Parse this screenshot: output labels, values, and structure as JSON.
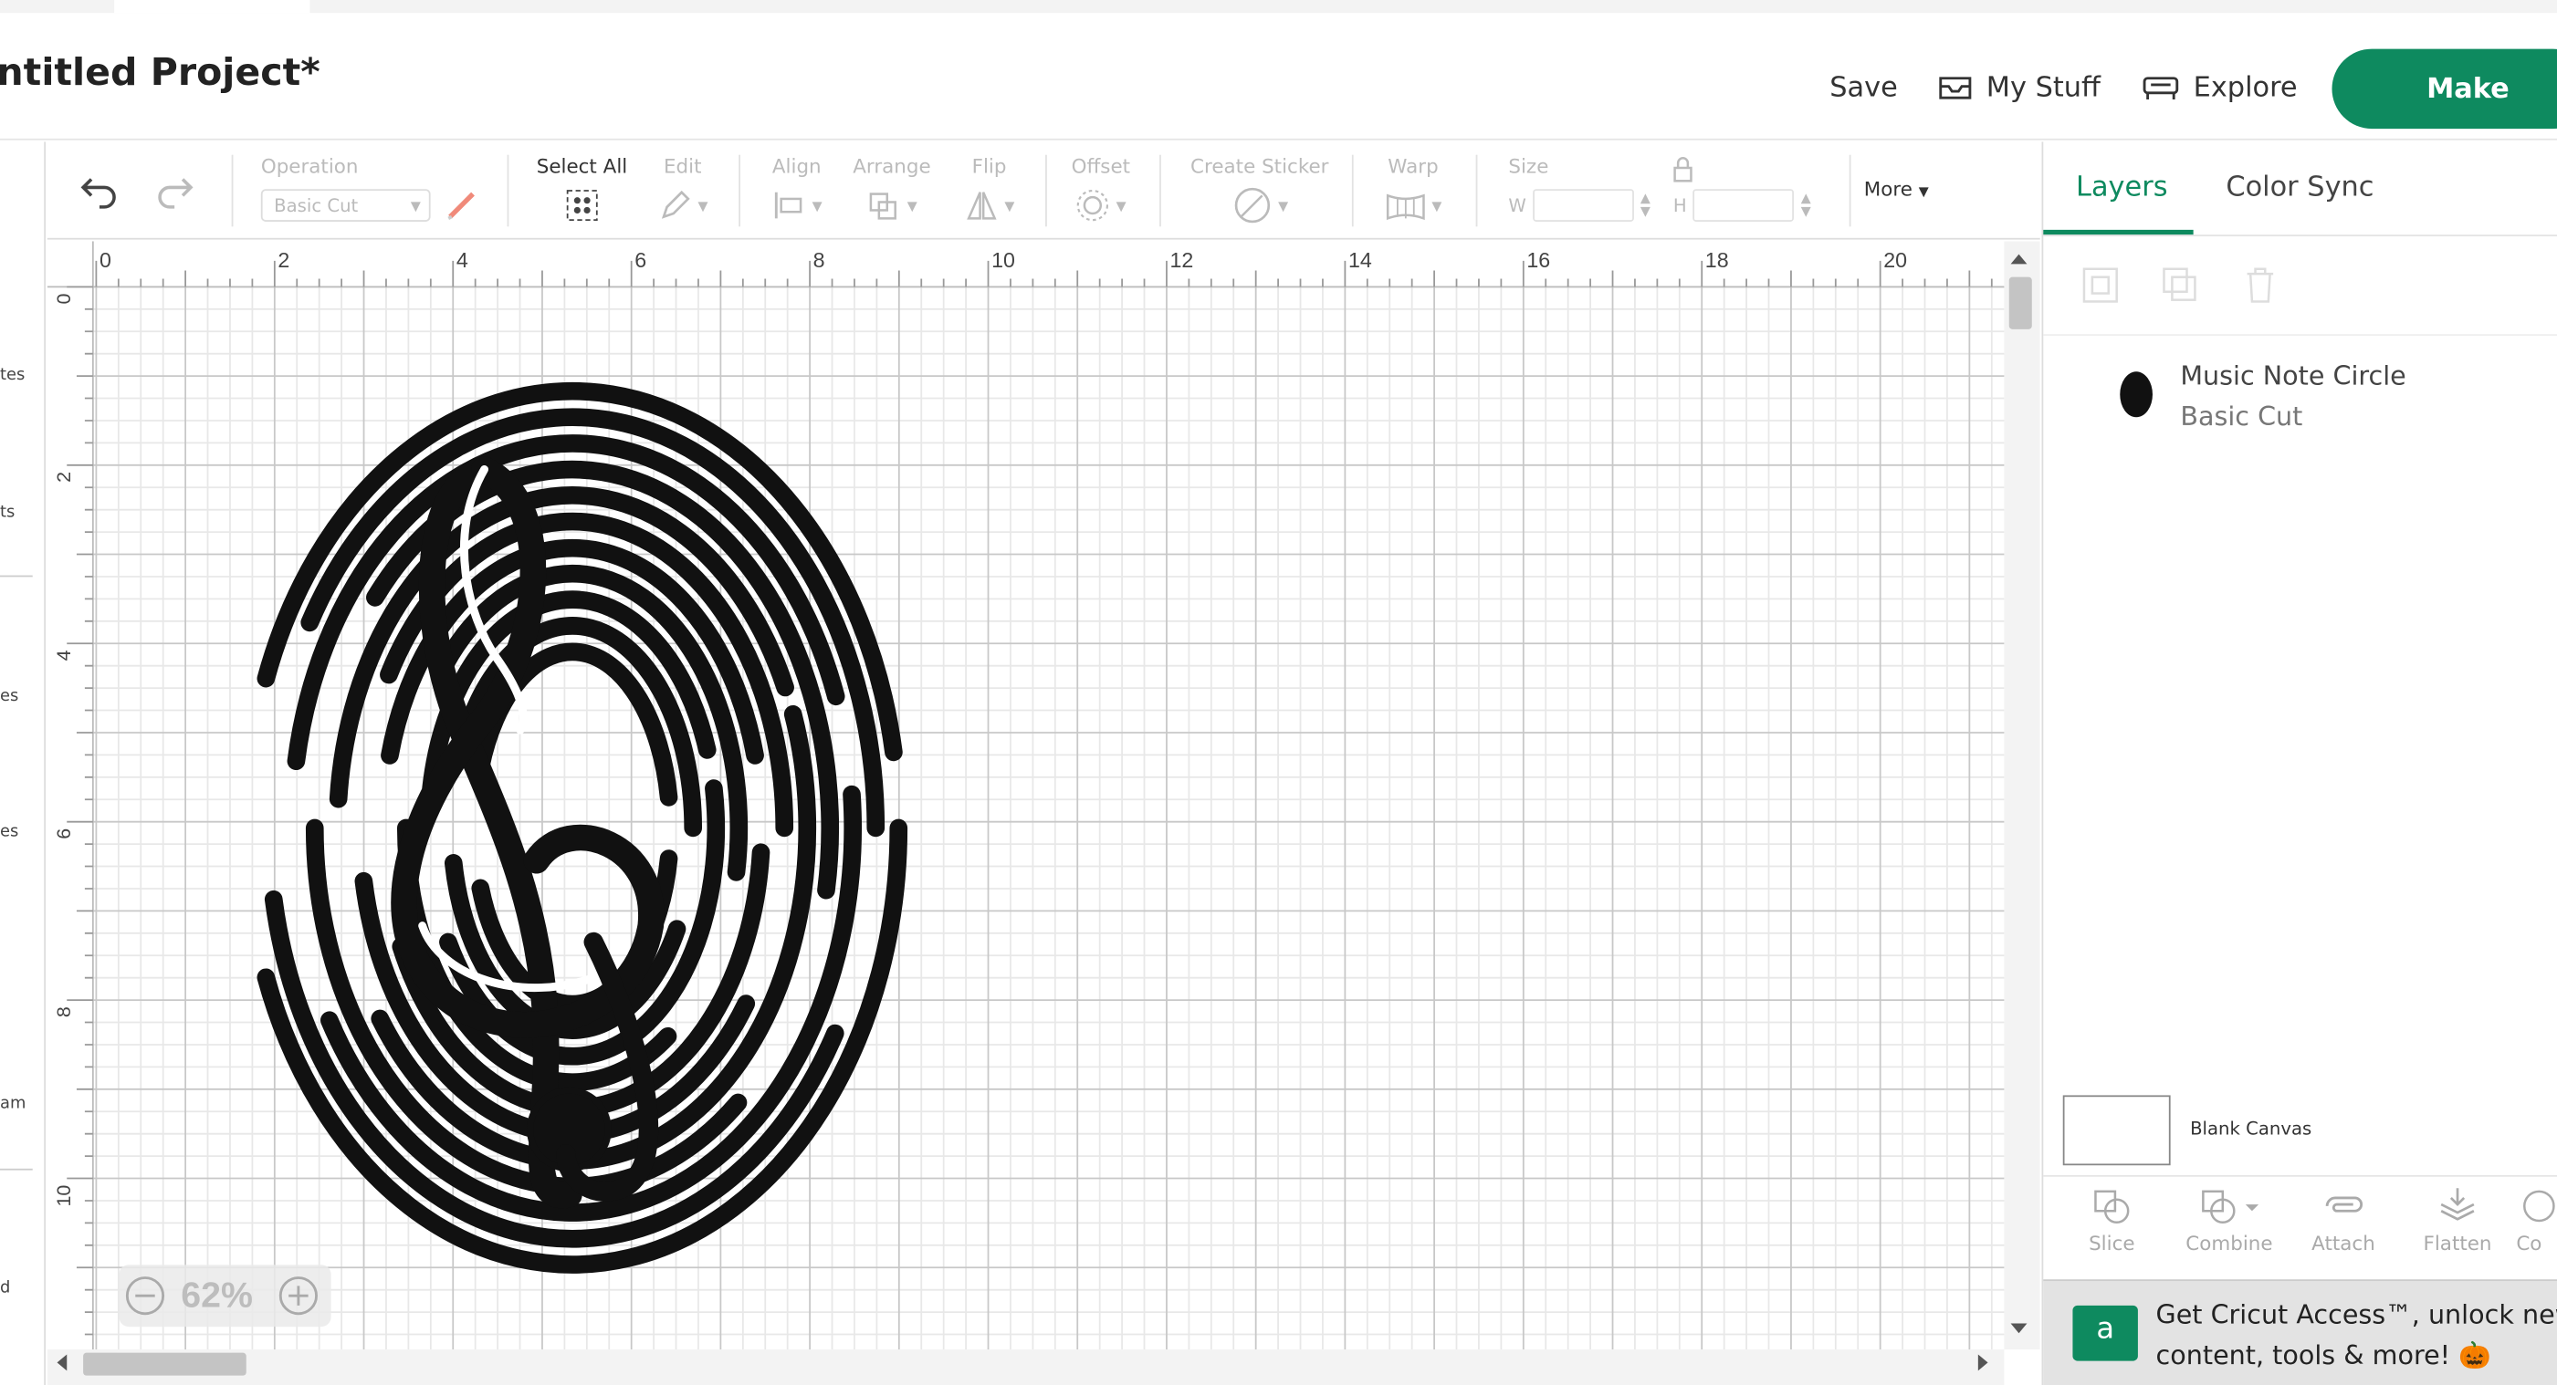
{
  "header": {
    "title": "ntitled Project*",
    "save_label": "Save",
    "mystuff_label": "My Stuff",
    "explore_label": "Explore",
    "make_label": "Make"
  },
  "left_rail": {
    "items": [
      "tes",
      "ts",
      "es",
      "es",
      "am",
      "d"
    ]
  },
  "toolbar": {
    "operation_label": "Operation",
    "operation_value": "Basic Cut",
    "select_all_label": "Select All",
    "edit_label": "Edit",
    "align_label": "Align",
    "arrange_label": "Arrange",
    "flip_label": "Flip",
    "offset_label": "Offset",
    "create_sticker_label": "Create Sticker",
    "warp_label": "Warp",
    "size_label": "Size",
    "w_label": "W",
    "h_label": "H",
    "more_label": "More"
  },
  "canvas": {
    "ruler_top": [
      "0",
      "2",
      "4",
      "6",
      "8",
      "10",
      "12",
      "14",
      "16",
      "18",
      "20"
    ],
    "ruler_left": [
      "0",
      "2",
      "4",
      "6",
      "8",
      "10"
    ],
    "zoom_value": "62%",
    "zoom_percent": 62
  },
  "right_panel": {
    "tabs": [
      "Layers",
      "Color Sync"
    ],
    "active_tab": "Layers",
    "layer": {
      "name": "Music Note Circle",
      "operation": "Basic Cut"
    },
    "blank_canvas_label": "Blank Canvas",
    "bottom_tools": [
      "Slice",
      "Combine",
      "Attach",
      "Flatten",
      "Co"
    ],
    "promo_line1": "Get Cricut Access™, unlock new",
    "promo_line2": "content, tools & more! 🎃",
    "promo_icon_letter": "a"
  },
  "colors": {
    "accent": "#0e8a5f",
    "grid_minor": "#e8e8e8",
    "grid_major": "#c8c8c8"
  }
}
